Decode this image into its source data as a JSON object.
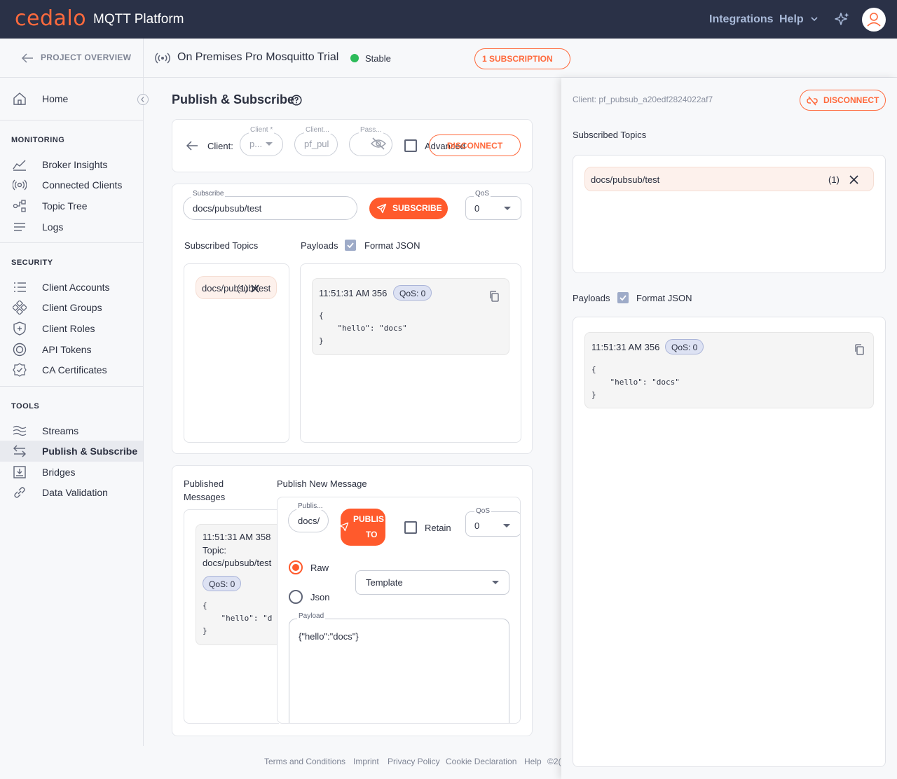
{
  "topbar": {
    "logo": "cedalo",
    "product": "MQTT Platform",
    "integrations": "Integrations",
    "help": "Help"
  },
  "sidebar": {
    "project_overview": "PROJECT OVERVIEW",
    "home": "Home",
    "monitoring_header": "MONITORING",
    "monitoring": [
      "Broker Insights",
      "Connected Clients",
      "Topic Tree",
      "Logs"
    ],
    "security_header": "SECURITY",
    "security": [
      "Client Accounts",
      "Client Groups",
      "Client Roles",
      "API Tokens",
      "CA Certificates"
    ],
    "tools_header": "TOOLS",
    "tools": [
      "Streams",
      "Publish & Subscribe",
      "Bridges",
      "Data Validation"
    ],
    "active_item": "Publish & Subscribe"
  },
  "header": {
    "broker_name": "On Premises Pro Mosquitto Trial",
    "status": "Stable",
    "status_color": "#2dbb5a",
    "subscriptions_pill": "1 SUBSCRIPTION"
  },
  "page": {
    "title": "Publish & Subscribe"
  },
  "connection": {
    "client_label": "Client:",
    "client_select_label": "Client *",
    "client_select_value": "p...",
    "client_id_label": "Client...",
    "client_id_value": "pf_pul",
    "password_label": "Pass...",
    "advanced_label": "Advanced",
    "disconnect_label": "DISCONNECT"
  },
  "subscribe": {
    "field_label": "Subscribe",
    "topic": "docs/pubsub/test",
    "button": "SUBSCRIBE",
    "qos_label": "QoS",
    "qos_value": "0",
    "subscribed_topics_label": "Subscribed Topics",
    "payloads_label": "Payloads",
    "format_json_label": "Format JSON",
    "format_json_checked": true,
    "chip_topic": "docs/pubsub/test",
    "chip_count": "(1)",
    "message": {
      "time": "11:51:31 AM 356",
      "qos": "QoS: 0",
      "payload_lines": [
        "{",
        "    \"hello\": \"docs\"",
        "}"
      ]
    }
  },
  "publish": {
    "published_messages_label_1": "Published",
    "published_messages_label_2": "Messages",
    "new_message_label": "Publish New Message",
    "published_item": {
      "time": "11:51:31 AM 358",
      "topic_label": "Topic:",
      "topic": "docs/pubsub/test",
      "qos": "QoS: 0",
      "payload_lines": [
        "{",
        "    \"hello\": \"d",
        "}"
      ]
    },
    "topic_field_label": "Publis...",
    "topic_field_value": "docs/",
    "publish_button_line1": "PUBLIS",
    "publish_button_line2": "TO",
    "retain_label": "Retain",
    "qos_label": "QoS",
    "qos_value": "0",
    "raw_label": "Raw",
    "json_label": "Json",
    "template_label": "Template",
    "payload_label": "Payload",
    "payload_value": "{\"hello\":\"docs\"}"
  },
  "right_panel": {
    "client_id": "Client: pf_pubsub_a20edf2824022af7",
    "disconnect_label": "DISCONNECT",
    "subscribed_topics_label": "Subscribed Topics",
    "chip_topic": "docs/pubsub/test",
    "chip_count": "(1)",
    "payloads_label": "Payloads",
    "format_json_label": "Format JSON",
    "message": {
      "time": "11:51:31 AM 356",
      "qos": "QoS: 0",
      "payload_lines": [
        "{",
        "    \"hello\": \"docs\"",
        "}"
      ]
    }
  },
  "footer": {
    "links": [
      "Terms and Conditions",
      "Imprint",
      "Privacy Policy",
      "Cookie Declaration",
      "Help"
    ],
    "copyright": "©2("
  }
}
